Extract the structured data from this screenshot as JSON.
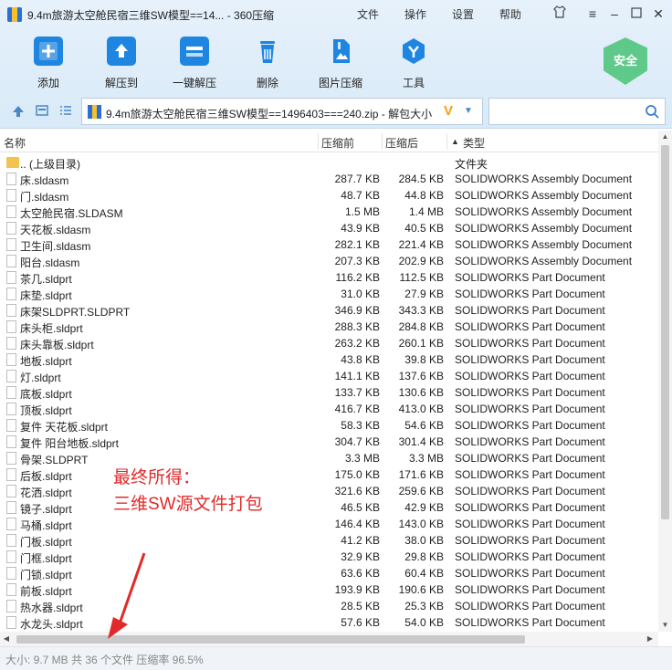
{
  "window": {
    "title": "9.4m旅游太空舱民宿三维SW模型==14... - 360压缩",
    "menu": [
      "文件",
      "操作",
      "设置",
      "帮助"
    ],
    "controls": [
      "shirt-icon",
      "menu-icon",
      "minimize-icon",
      "maximize-icon",
      "close-icon"
    ]
  },
  "toolbar": {
    "items": [
      {
        "label": "添加",
        "icon": "add-icon"
      },
      {
        "label": "解压到",
        "icon": "extract-to-icon"
      },
      {
        "label": "一键解压",
        "icon": "one-click-extract-icon"
      },
      {
        "label": "删除",
        "icon": "delete-icon"
      },
      {
        "label": "图片压缩",
        "icon": "image-compress-icon"
      },
      {
        "label": "工具",
        "icon": "tools-icon"
      }
    ],
    "safe_label": "安全"
  },
  "nav": {
    "path": "9.4m旅游太空舱民宿三维SW模型==1496403===240.zip - 解包大小",
    "search_placeholder": ""
  },
  "columns": {
    "name": "名称",
    "compressed": "压缩前",
    "original": "压缩后",
    "type": "类型"
  },
  "files": [
    {
      "name": ".. (上级目录)",
      "before": "",
      "after": "",
      "type": "文件夹",
      "folder": true
    },
    {
      "name": "床.sldasm",
      "before": "287.7 KB",
      "after": "284.5 KB",
      "type": "SOLIDWORKS Assembly Document"
    },
    {
      "name": "门.sldasm",
      "before": "48.7 KB",
      "after": "44.8 KB",
      "type": "SOLIDWORKS Assembly Document"
    },
    {
      "name": "太空舱民宿.SLDASM",
      "before": "1.5 MB",
      "after": "1.4 MB",
      "type": "SOLIDWORKS Assembly Document"
    },
    {
      "name": "天花板.sldasm",
      "before": "43.9 KB",
      "after": "40.5 KB",
      "type": "SOLIDWORKS Assembly Document"
    },
    {
      "name": "卫生间.sldasm",
      "before": "282.1 KB",
      "after": "221.4 KB",
      "type": "SOLIDWORKS Assembly Document"
    },
    {
      "name": "阳台.sldasm",
      "before": "207.3 KB",
      "after": "202.9 KB",
      "type": "SOLIDWORKS Assembly Document"
    },
    {
      "name": "茶几.sldprt",
      "before": "116.2 KB",
      "after": "112.5 KB",
      "type": "SOLIDWORKS Part Document"
    },
    {
      "name": "床垫.sldprt",
      "before": "31.0 KB",
      "after": "27.9 KB",
      "type": "SOLIDWORKS Part Document"
    },
    {
      "name": "床架SLDPRT.SLDPRT",
      "before": "346.9 KB",
      "after": "343.3 KB",
      "type": "SOLIDWORKS Part Document"
    },
    {
      "name": "床头柜.sldprt",
      "before": "288.3 KB",
      "after": "284.8 KB",
      "type": "SOLIDWORKS Part Document"
    },
    {
      "name": "床头靠板.sldprt",
      "before": "263.2 KB",
      "after": "260.1 KB",
      "type": "SOLIDWORKS Part Document"
    },
    {
      "name": "地板.sldprt",
      "before": "43.8 KB",
      "after": "39.8 KB",
      "type": "SOLIDWORKS Part Document"
    },
    {
      "name": "灯.sldprt",
      "before": "141.1 KB",
      "after": "137.6 KB",
      "type": "SOLIDWORKS Part Document"
    },
    {
      "name": "底板.sldprt",
      "before": "133.7 KB",
      "after": "130.6 KB",
      "type": "SOLIDWORKS Part Document"
    },
    {
      "name": "顶板.sldprt",
      "before": "416.7 KB",
      "after": "413.0 KB",
      "type": "SOLIDWORKS Part Document"
    },
    {
      "name": "复件 天花板.sldprt",
      "before": "58.3 KB",
      "after": "54.6 KB",
      "type": "SOLIDWORKS Part Document"
    },
    {
      "name": "复件 阳台地板.sldprt",
      "before": "304.7 KB",
      "after": "301.4 KB",
      "type": "SOLIDWORKS Part Document"
    },
    {
      "name": "骨架.SLDPRT",
      "before": "3.3 MB",
      "after": "3.3 MB",
      "type": "SOLIDWORKS Part Document"
    },
    {
      "name": "后板.sldprt",
      "before": "175.0 KB",
      "after": "171.6 KB",
      "type": "SOLIDWORKS Part Document"
    },
    {
      "name": "花洒.sldprt",
      "before": "321.6 KB",
      "after": "259.6 KB",
      "type": "SOLIDWORKS Part Document"
    },
    {
      "name": "镜子.sldprt",
      "before": "46.5 KB",
      "after": "42.9 KB",
      "type": "SOLIDWORKS Part Document"
    },
    {
      "name": "马桶.sldprt",
      "before": "146.4 KB",
      "after": "143.0 KB",
      "type": "SOLIDWORKS Part Document"
    },
    {
      "name": "门板.sldprt",
      "before": "41.2 KB",
      "after": "38.0 KB",
      "type": "SOLIDWORKS Part Document"
    },
    {
      "name": "门框.sldprt",
      "before": "32.9 KB",
      "after": "29.8 KB",
      "type": "SOLIDWORKS Part Document"
    },
    {
      "name": "门锁.sldprt",
      "before": "63.6 KB",
      "after": "60.4 KB",
      "type": "SOLIDWORKS Part Document"
    },
    {
      "name": "前板.sldprt",
      "before": "193.9 KB",
      "after": "190.6 KB",
      "type": "SOLIDWORKS Part Document"
    },
    {
      "name": "热水器.sldprt",
      "before": "28.5 KB",
      "after": "25.3 KB",
      "type": "SOLIDWORKS Part Document"
    },
    {
      "name": "水龙头.sldprt",
      "before": "57.6 KB",
      "after": "54.0 KB",
      "type": "SOLIDWORKS Part Document"
    }
  ],
  "annotation": {
    "line1": "最终所得：",
    "line2": "三维SW源文件打包"
  },
  "status": {
    "text": "大小: 9.7 MB 共 36 个文件 压缩率 96.5%"
  },
  "colors": {
    "accent": "#1e86e0",
    "annotation": "#e02a2a",
    "safe": "#5fc98a"
  }
}
